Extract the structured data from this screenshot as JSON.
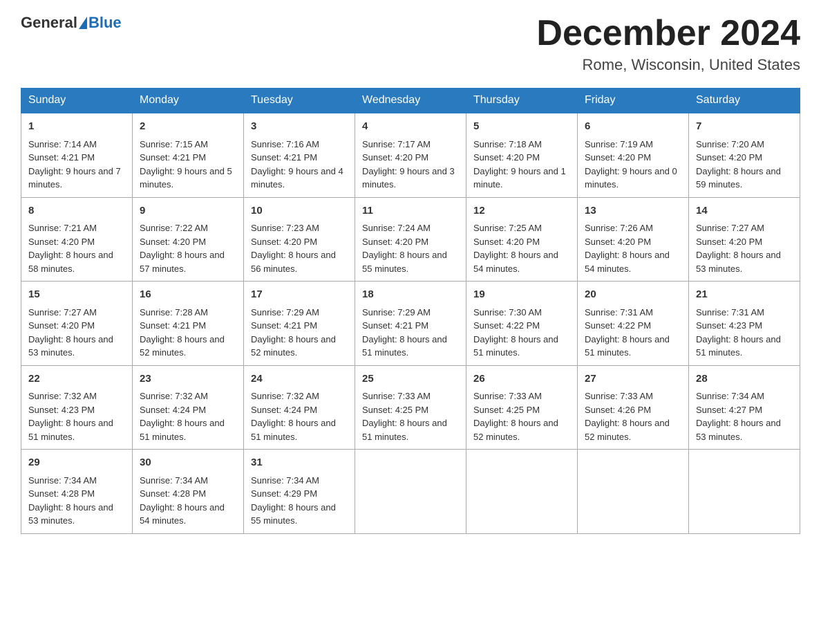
{
  "logo": {
    "general": "General",
    "blue": "Blue"
  },
  "header": {
    "month_year": "December 2024",
    "location": "Rome, Wisconsin, United States"
  },
  "weekdays": [
    "Sunday",
    "Monday",
    "Tuesday",
    "Wednesday",
    "Thursday",
    "Friday",
    "Saturday"
  ],
  "weeks": [
    [
      {
        "day": "1",
        "sunrise": "7:14 AM",
        "sunset": "4:21 PM",
        "daylight": "9 hours and 7 minutes."
      },
      {
        "day": "2",
        "sunrise": "7:15 AM",
        "sunset": "4:21 PM",
        "daylight": "9 hours and 5 minutes."
      },
      {
        "day": "3",
        "sunrise": "7:16 AM",
        "sunset": "4:21 PM",
        "daylight": "9 hours and 4 minutes."
      },
      {
        "day": "4",
        "sunrise": "7:17 AM",
        "sunset": "4:20 PM",
        "daylight": "9 hours and 3 minutes."
      },
      {
        "day": "5",
        "sunrise": "7:18 AM",
        "sunset": "4:20 PM",
        "daylight": "9 hours and 1 minute."
      },
      {
        "day": "6",
        "sunrise": "7:19 AM",
        "sunset": "4:20 PM",
        "daylight": "9 hours and 0 minutes."
      },
      {
        "day": "7",
        "sunrise": "7:20 AM",
        "sunset": "4:20 PM",
        "daylight": "8 hours and 59 minutes."
      }
    ],
    [
      {
        "day": "8",
        "sunrise": "7:21 AM",
        "sunset": "4:20 PM",
        "daylight": "8 hours and 58 minutes."
      },
      {
        "day": "9",
        "sunrise": "7:22 AM",
        "sunset": "4:20 PM",
        "daylight": "8 hours and 57 minutes."
      },
      {
        "day": "10",
        "sunrise": "7:23 AM",
        "sunset": "4:20 PM",
        "daylight": "8 hours and 56 minutes."
      },
      {
        "day": "11",
        "sunrise": "7:24 AM",
        "sunset": "4:20 PM",
        "daylight": "8 hours and 55 minutes."
      },
      {
        "day": "12",
        "sunrise": "7:25 AM",
        "sunset": "4:20 PM",
        "daylight": "8 hours and 54 minutes."
      },
      {
        "day": "13",
        "sunrise": "7:26 AM",
        "sunset": "4:20 PM",
        "daylight": "8 hours and 54 minutes."
      },
      {
        "day": "14",
        "sunrise": "7:27 AM",
        "sunset": "4:20 PM",
        "daylight": "8 hours and 53 minutes."
      }
    ],
    [
      {
        "day": "15",
        "sunrise": "7:27 AM",
        "sunset": "4:20 PM",
        "daylight": "8 hours and 53 minutes."
      },
      {
        "day": "16",
        "sunrise": "7:28 AM",
        "sunset": "4:21 PM",
        "daylight": "8 hours and 52 minutes."
      },
      {
        "day": "17",
        "sunrise": "7:29 AM",
        "sunset": "4:21 PM",
        "daylight": "8 hours and 52 minutes."
      },
      {
        "day": "18",
        "sunrise": "7:29 AM",
        "sunset": "4:21 PM",
        "daylight": "8 hours and 51 minutes."
      },
      {
        "day": "19",
        "sunrise": "7:30 AM",
        "sunset": "4:22 PM",
        "daylight": "8 hours and 51 minutes."
      },
      {
        "day": "20",
        "sunrise": "7:31 AM",
        "sunset": "4:22 PM",
        "daylight": "8 hours and 51 minutes."
      },
      {
        "day": "21",
        "sunrise": "7:31 AM",
        "sunset": "4:23 PM",
        "daylight": "8 hours and 51 minutes."
      }
    ],
    [
      {
        "day": "22",
        "sunrise": "7:32 AM",
        "sunset": "4:23 PM",
        "daylight": "8 hours and 51 minutes."
      },
      {
        "day": "23",
        "sunrise": "7:32 AM",
        "sunset": "4:24 PM",
        "daylight": "8 hours and 51 minutes."
      },
      {
        "day": "24",
        "sunrise": "7:32 AM",
        "sunset": "4:24 PM",
        "daylight": "8 hours and 51 minutes."
      },
      {
        "day": "25",
        "sunrise": "7:33 AM",
        "sunset": "4:25 PM",
        "daylight": "8 hours and 51 minutes."
      },
      {
        "day": "26",
        "sunrise": "7:33 AM",
        "sunset": "4:25 PM",
        "daylight": "8 hours and 52 minutes."
      },
      {
        "day": "27",
        "sunrise": "7:33 AM",
        "sunset": "4:26 PM",
        "daylight": "8 hours and 52 minutes."
      },
      {
        "day": "28",
        "sunrise": "7:34 AM",
        "sunset": "4:27 PM",
        "daylight": "8 hours and 53 minutes."
      }
    ],
    [
      {
        "day": "29",
        "sunrise": "7:34 AM",
        "sunset": "4:28 PM",
        "daylight": "8 hours and 53 minutes."
      },
      {
        "day": "30",
        "sunrise": "7:34 AM",
        "sunset": "4:28 PM",
        "daylight": "8 hours and 54 minutes."
      },
      {
        "day": "31",
        "sunrise": "7:34 AM",
        "sunset": "4:29 PM",
        "daylight": "8 hours and 55 minutes."
      },
      null,
      null,
      null,
      null
    ]
  ],
  "labels": {
    "sunrise": "Sunrise:",
    "sunset": "Sunset:",
    "daylight": "Daylight:"
  }
}
